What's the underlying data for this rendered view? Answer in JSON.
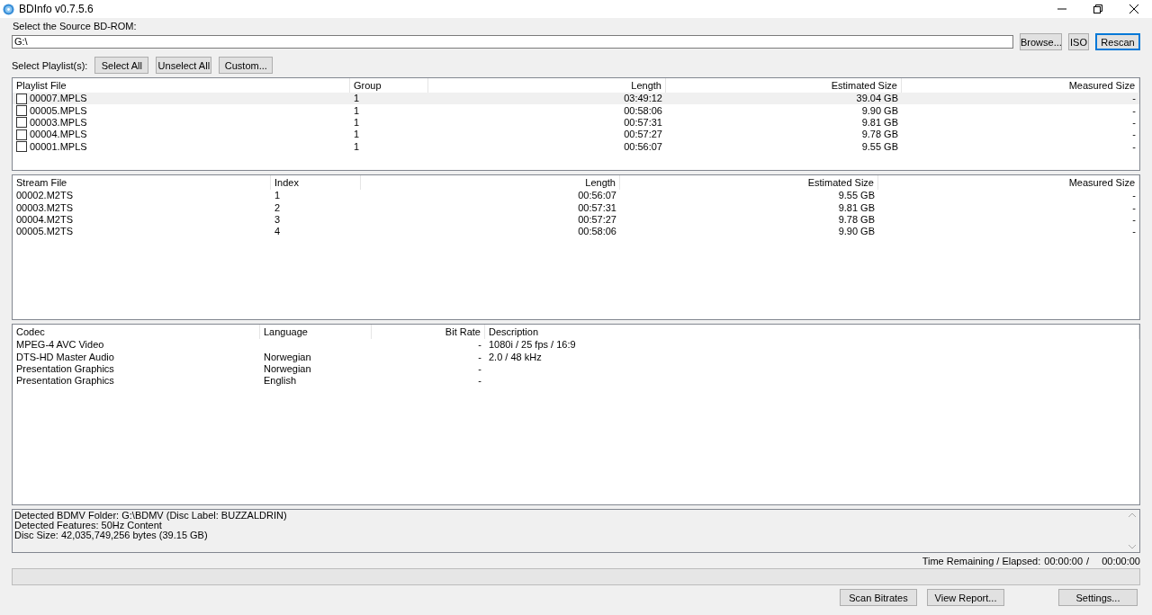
{
  "window": {
    "title": "BDInfo v0.7.5.6"
  },
  "source": {
    "label": "Select the Source BD-ROM:",
    "path": "G:\\",
    "buttons": [
      {
        "label": "Browse...",
        "focused": false
      },
      {
        "label": "ISO",
        "focused": false
      },
      {
        "label": "Rescan",
        "focused": true
      }
    ]
  },
  "playlist_select": {
    "label": "Select Playlist(s):",
    "buttons": [
      "Select All",
      "Unselect All",
      "Custom..."
    ]
  },
  "playlist_table": {
    "columns": [
      "Playlist File",
      "Group",
      "Length",
      "Estimated Size",
      "Measured Size"
    ],
    "rows": [
      {
        "checked": false,
        "selected": true,
        "cells": [
          "00007.MPLS",
          "1",
          "03:49:12",
          "39.04 GB",
          "-"
        ]
      },
      {
        "checked": false,
        "selected": false,
        "cells": [
          "00005.MPLS",
          "1",
          "00:58:06",
          "9.90 GB",
          "-"
        ]
      },
      {
        "checked": false,
        "selected": false,
        "cells": [
          "00003.MPLS",
          "1",
          "00:57:31",
          "9.81 GB",
          "-"
        ]
      },
      {
        "checked": false,
        "selected": false,
        "cells": [
          "00004.MPLS",
          "1",
          "00:57:27",
          "9.78 GB",
          "-"
        ]
      },
      {
        "checked": false,
        "selected": false,
        "cells": [
          "00001.MPLS",
          "1",
          "00:56:07",
          "9.55 GB",
          "-"
        ]
      }
    ]
  },
  "stream_table": {
    "columns": [
      "Stream File",
      "Index",
      "Length",
      "Estimated Size",
      "Measured Size"
    ],
    "rows": [
      {
        "cells": [
          "00002.M2TS",
          "1",
          "00:56:07",
          "9.55 GB",
          "-"
        ]
      },
      {
        "cells": [
          "00003.M2TS",
          "2",
          "00:57:31",
          "9.81 GB",
          "-"
        ]
      },
      {
        "cells": [
          "00004.M2TS",
          "3",
          "00:57:27",
          "9.78 GB",
          "-"
        ]
      },
      {
        "cells": [
          "00005.M2TS",
          "4",
          "00:58:06",
          "9.90 GB",
          "-"
        ]
      }
    ]
  },
  "codec_table": {
    "columns": [
      "Codec",
      "Language",
      "Bit Rate",
      "Description"
    ],
    "rows": [
      {
        "cells": [
          "MPEG-4 AVC Video",
          "",
          "-",
          "1080i / 25 fps / 16:9"
        ]
      },
      {
        "cells": [
          "DTS-HD Master Audio",
          "Norwegian",
          "-",
          "2.0 / 48 kHz"
        ]
      },
      {
        "cells": [
          "Presentation Graphics",
          "Norwegian",
          "-",
          ""
        ]
      },
      {
        "cells": [
          "Presentation Graphics",
          "English",
          "-",
          ""
        ]
      }
    ]
  },
  "info_lines": [
    "Detected BDMV Folder: G:\\BDMV (Disc Label: BUZZALDRIN)",
    "Detected Features: 50Hz Content",
    "Disc Size: 42,035,749,256 bytes (39.15 GB)"
  ],
  "time": {
    "label": "Time Remaining / Elapsed:",
    "remaining": "00:00:00",
    "separator": "/",
    "elapsed": "00:00:00"
  },
  "progress": {
    "level": 0
  },
  "bottom_buttons": [
    "Scan Bitrates",
    "View Report...",
    "Settings..."
  ]
}
